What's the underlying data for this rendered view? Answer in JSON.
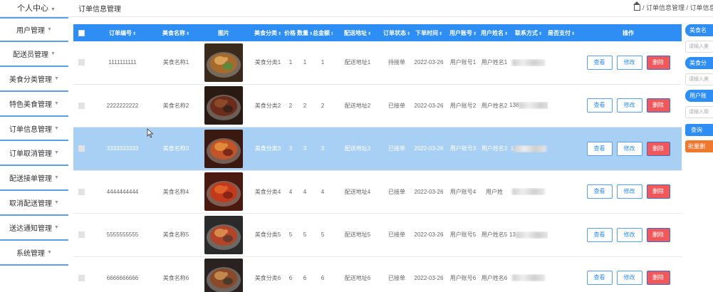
{
  "header": {
    "user_menu": "个人中心",
    "page_title": "订单信息管理",
    "breadcrumb": "/ 订单信息管理 / 订单信息"
  },
  "sidebar": {
    "items": [
      {
        "label": "用户管理"
      },
      {
        "label": "配送员管理"
      },
      {
        "label": "美食分类管理"
      },
      {
        "label": "特色美食管理"
      },
      {
        "label": "订单信息管理"
      },
      {
        "label": "订单取消管理"
      },
      {
        "label": "配送接单管理"
      },
      {
        "label": "取消配送管理"
      },
      {
        "label": "送达通知管理"
      },
      {
        "label": "系统管理"
      }
    ]
  },
  "table": {
    "columns": [
      "订单编号",
      "美食名称",
      "图片",
      "美食分类",
      "价格",
      "数量",
      "总金额",
      "配送地址",
      "订单状态",
      "下单时间",
      "用户账号",
      "用户姓名",
      "联系方式",
      "是否支付",
      "操作"
    ],
    "rows": [
      {
        "no": "1111111111",
        "name": "美食名称1",
        "cat": "美食分类1",
        "price": "1",
        "qty": "1",
        "total": "1",
        "addr": "配送地址1",
        "status": "待接单",
        "time": "2022-03-26",
        "acct": "用户账号1",
        "uname": "用户姓名1",
        "phone": "",
        "selected": false
      },
      {
        "no": "2222222222",
        "name": "美食名称2",
        "cat": "美食分类2",
        "price": "2",
        "qty": "2",
        "total": "2",
        "addr": "配送地址2",
        "status": "已接单",
        "time": "2022-03-26",
        "acct": "用户账号2",
        "uname": "用户姓名2",
        "phone": "138",
        "selected": false
      },
      {
        "no": "3333333333",
        "name": "美食名称3",
        "cat": "美食分类3",
        "price": "3",
        "qty": "3",
        "total": "3",
        "addr": "配送地址3",
        "status": "已接单",
        "time": "2022-03-26",
        "acct": "用户账号3",
        "uname": "用户姓名3",
        "phone": "1",
        "selected": true
      },
      {
        "no": "4444444444",
        "name": "美食名称4",
        "cat": "美食分类4",
        "price": "4",
        "qty": "4",
        "total": "4",
        "addr": "配送地址4",
        "status": "已接单",
        "time": "2022-03-26",
        "acct": "用户账号4",
        "uname": "用户姓",
        "phone": "",
        "selected": false
      },
      {
        "no": "5555555555",
        "name": "美食名称5",
        "cat": "美食分类5",
        "price": "5",
        "qty": "5",
        "total": "5",
        "addr": "配送地址5",
        "status": "已接单",
        "time": "2022-03-26",
        "acct": "用户账号5",
        "uname": "用户姓名5",
        "phone": "13",
        "selected": false
      },
      {
        "no": "6666666666",
        "name": "美食名称6",
        "cat": "美食分类6",
        "price": "6",
        "qty": "6",
        "total": "6",
        "addr": "配送地址6",
        "status": "已接单",
        "time": "2022-03-26",
        "acct": "用户账号6",
        "uname": "用户姓名6",
        "phone": "",
        "selected": false
      }
    ],
    "actions": {
      "view": "查看",
      "edit": "修改",
      "delete": "删除"
    }
  },
  "search_panel": {
    "label1": "美食名",
    "placeholder1": "请输入美",
    "label2": "美食分",
    "placeholder2": "请输入美",
    "label3": "用户账",
    "placeholder3": "请输入用",
    "search_btn": "查询",
    "batch_btn": "批量删"
  },
  "colors": {
    "primary": "#2e8ef3",
    "danger": "#f0585b",
    "selected_row": "#a8d0f5",
    "batch": "#f07930"
  }
}
